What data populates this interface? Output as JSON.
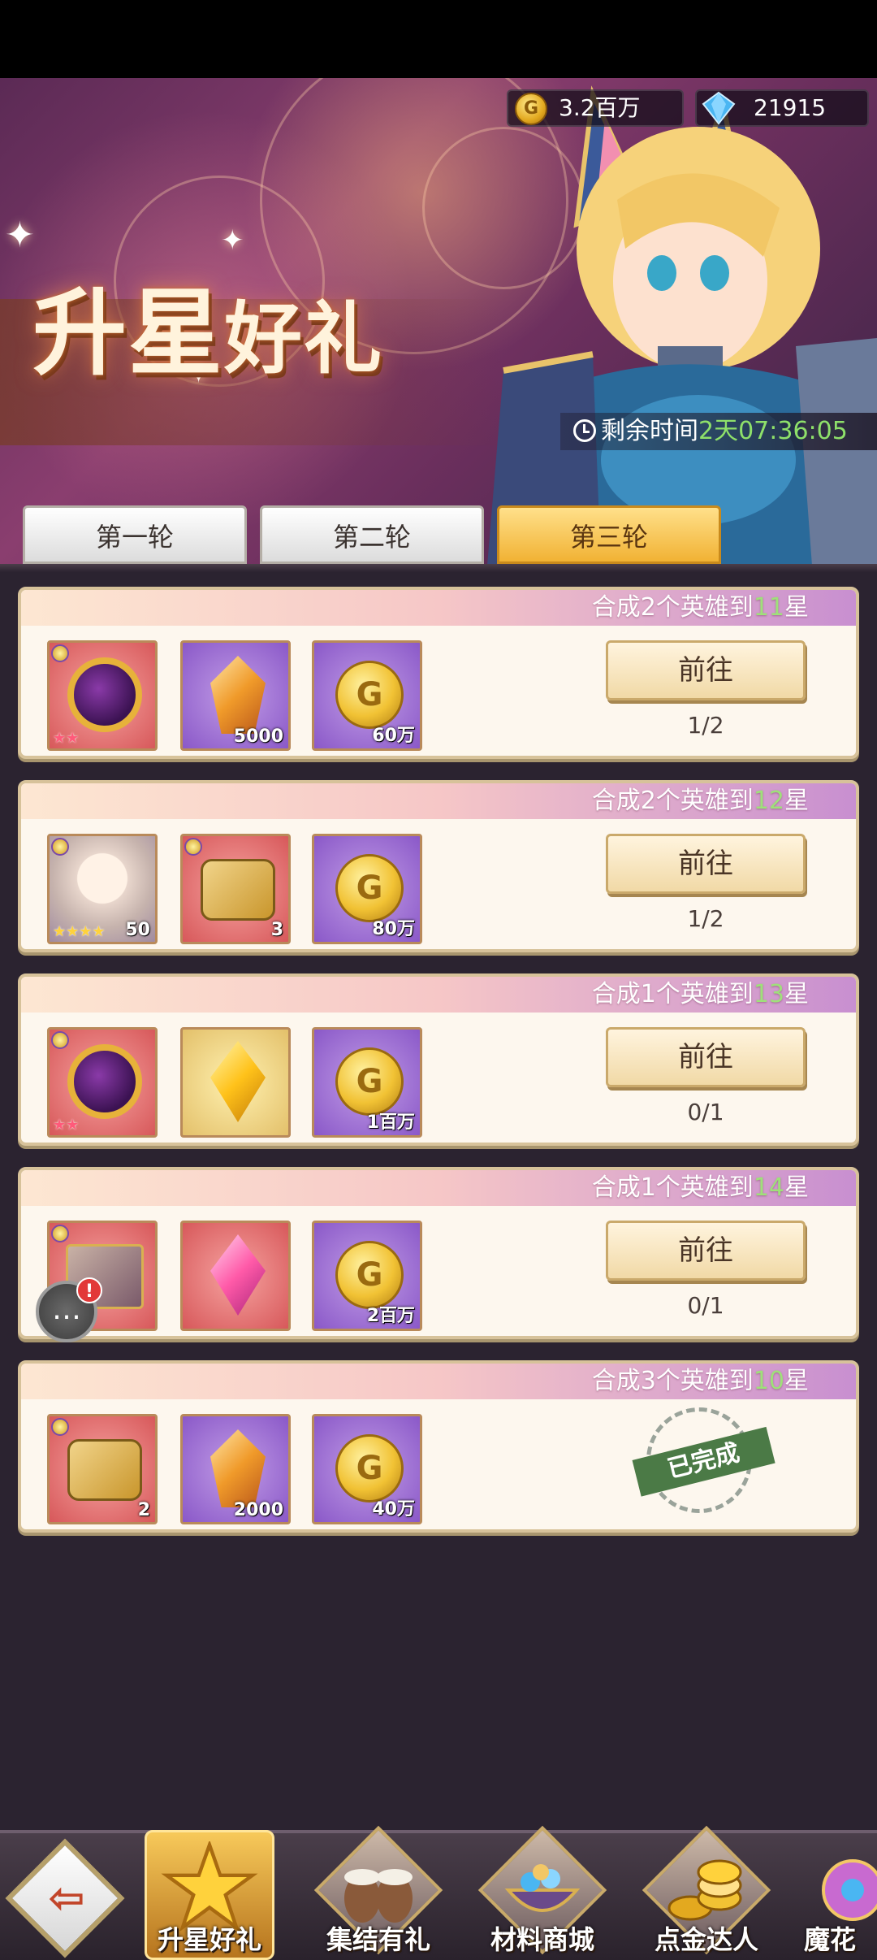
{
  "currency": {
    "gold": "3.2百万",
    "diamonds": "21915"
  },
  "banner": {
    "title_a": "升星",
    "title_b": "好礼"
  },
  "timer": {
    "label": "剩余时间",
    "days": "2天",
    "time": "07:36:05"
  },
  "tabs": [
    {
      "label": "第一轮"
    },
    {
      "label": "第二轮"
    },
    {
      "label": "第三轮"
    }
  ],
  "tasks": [
    {
      "title_prefix": "合成2个英雄到",
      "title_num": "11",
      "title_suffix": "星",
      "rewards": [
        {
          "icon": "star-orb-icon",
          "qty": ""
        },
        {
          "icon": "amber-crystal-icon",
          "qty": "5000"
        },
        {
          "icon": "gold-coin-icon",
          "qty": "60万"
        }
      ],
      "button": "前往",
      "progress": "1/2"
    },
    {
      "title_prefix": "合成2个英雄到",
      "title_num": "12",
      "title_suffix": "星",
      "rewards": [
        {
          "icon": "hero-portrait-icon",
          "qty": "50"
        },
        {
          "icon": "puzzle-piece-icon",
          "qty": "3"
        },
        {
          "icon": "gold-coin-icon",
          "qty": "80万"
        }
      ],
      "button": "前往",
      "progress": "1/2"
    },
    {
      "title_prefix": "合成1个英雄到",
      "title_num": "13",
      "title_suffix": "星",
      "rewards": [
        {
          "icon": "star-orb-icon",
          "qty": ""
        },
        {
          "icon": "yellow-gem-icon",
          "qty": ""
        },
        {
          "icon": "gold-coin-icon",
          "qty": "1百万"
        }
      ],
      "button": "前往",
      "progress": "0/1"
    },
    {
      "title_prefix": "合成1个英雄到",
      "title_num": "14",
      "title_suffix": "星",
      "rewards": [
        {
          "icon": "treasure-box-icon",
          "qty": ""
        },
        {
          "icon": "pink-gem-icon",
          "qty": ""
        },
        {
          "icon": "gold-coin-icon",
          "qty": "2百万"
        }
      ],
      "button": "前往",
      "progress": "0/1"
    },
    {
      "title_prefix": "合成3个英雄到",
      "title_num": "10",
      "title_suffix": "星",
      "rewards": [
        {
          "icon": "puzzle-piece-icon",
          "qty": "2"
        },
        {
          "icon": "amber-crystal-icon",
          "qty": "2000"
        },
        {
          "icon": "gold-coin-icon",
          "qty": "40万"
        }
      ],
      "completed": "已完成"
    }
  ],
  "chat": {
    "badge": "!"
  },
  "bottom_nav": [
    {
      "label": ""
    },
    {
      "label": "升星好礼"
    },
    {
      "label": "集结有礼"
    },
    {
      "label": "材料商城"
    },
    {
      "label": "点金达人"
    },
    {
      "label": "魔花"
    }
  ],
  "colors": {
    "accent_gold": "#f1b234",
    "progress_green": "#9fe07a",
    "timer_green": "#8ee06a"
  }
}
